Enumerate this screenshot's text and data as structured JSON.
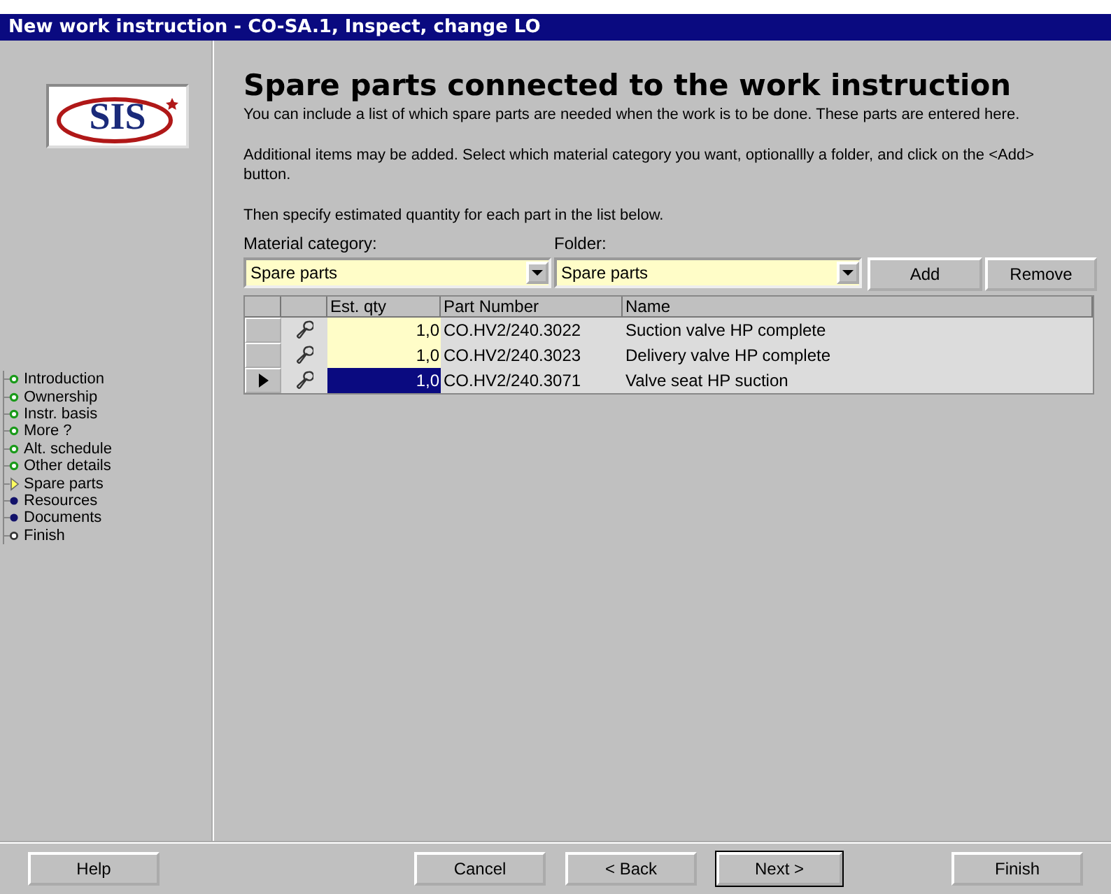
{
  "window": {
    "title": "New work instruction - CO-SA.1, Inspect, change LO"
  },
  "logo": {
    "text": "SIS"
  },
  "steps": [
    {
      "label": "Introduction",
      "kind": "done"
    },
    {
      "label": "Ownership",
      "kind": "done"
    },
    {
      "label": "Instr. basis",
      "kind": "done"
    },
    {
      "label": "More ?",
      "kind": "done"
    },
    {
      "label": "Alt. schedule",
      "kind": "done"
    },
    {
      "label": "Other details",
      "kind": "done"
    },
    {
      "label": "Spare parts",
      "kind": "current"
    },
    {
      "label": "Resources",
      "kind": "pending"
    },
    {
      "label": "Documents",
      "kind": "pending"
    },
    {
      "label": "Finish",
      "kind": "end"
    }
  ],
  "heading": "Spare parts connected to the work instruction",
  "paragraphs": [
    "You can include a list of which spare parts are needed when the work is to be done. These parts are entered here.",
    "Additional items may be added.  Select which material category you want, optionallly a folder, and click on the <Add> button.",
    "Then specify estimated quantity for each part in the list below."
  ],
  "material_category": {
    "label": "Material category:",
    "value": "Spare parts"
  },
  "folder": {
    "label": "Folder:",
    "value": "Spare parts"
  },
  "actions": [
    {
      "label": "Add"
    },
    {
      "label": "Remove"
    }
  ],
  "table": {
    "columns": [
      "Est. qty",
      "Part Number",
      "Name"
    ],
    "rows": [
      {
        "qty": "1,0",
        "part": "CO.HV2/240.3022",
        "name": "Suction valve HP complete",
        "selected": false
      },
      {
        "qty": "1,0",
        "part": "CO.HV2/240.3023",
        "name": "Delivery valve HP complete",
        "selected": false
      },
      {
        "qty": "1,0",
        "part": "CO.HV2/240.3071",
        "name": "Valve seat HP suction",
        "selected": true
      }
    ]
  },
  "footer_buttons": [
    {
      "label": "Help",
      "kind": "left"
    },
    {
      "label": "Cancel",
      "kind": "middle"
    },
    {
      "label": "< Back",
      "kind": "middle"
    },
    {
      "label": "Next >",
      "kind": "default"
    },
    {
      "label": "Finish",
      "kind": "right"
    }
  ]
}
